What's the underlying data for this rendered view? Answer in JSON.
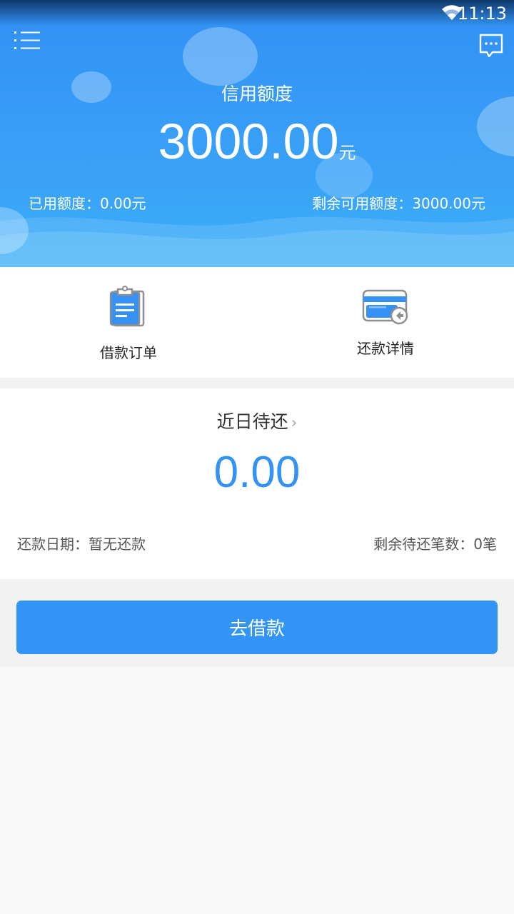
{
  "status_bar": {
    "time": "11:13"
  },
  "header": {
    "title": "信用额度",
    "amount": "3000.00",
    "unit": "元",
    "used": "已用额度：0.00元",
    "remaining": "剩余可用额度：3000.00元"
  },
  "shortcuts": [
    {
      "label": "借款订单",
      "icon": "clipboard-icon"
    },
    {
      "label": "还款详情",
      "icon": "card-repay-icon"
    }
  ],
  "recent": {
    "title": "近日待还",
    "chevron": "›",
    "amount": "0.00",
    "repay_date": "还款日期：暂无还款",
    "remain_count": "剩余待还笔数：0笔"
  },
  "action": {
    "borrow_label": "去借款"
  },
  "colors": {
    "primary": "#3295f6",
    "amount_text": "#3393f3"
  }
}
